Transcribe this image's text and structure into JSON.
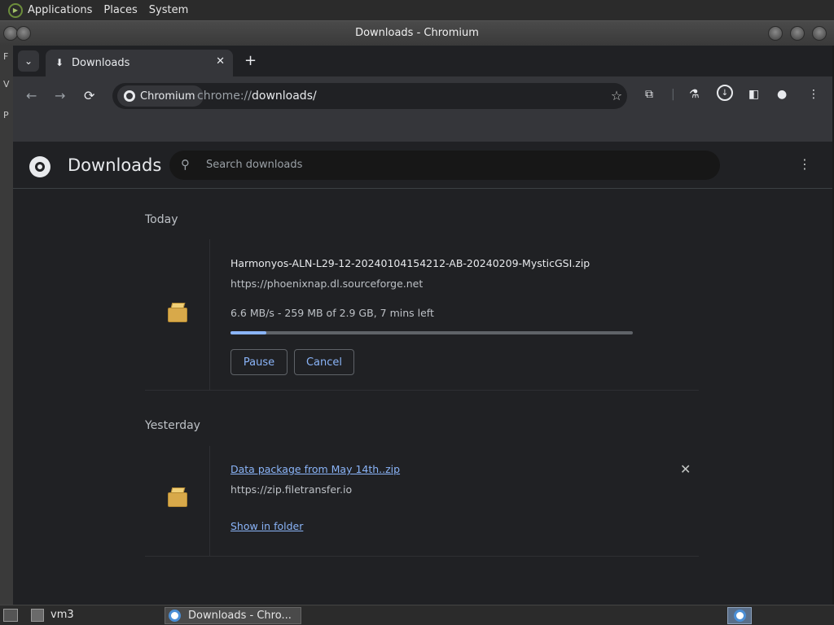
{
  "top_panel": {
    "menus": [
      "Applications",
      "Places",
      "System"
    ]
  },
  "window": {
    "title": "Downloads - Chromium"
  },
  "bg_window_fragments": [
    "F",
    "V",
    "P"
  ],
  "browser": {
    "tab": {
      "label": "Downloads",
      "close_glyph": "✕",
      "icon": "download-icon"
    },
    "new_tab_glyph": "+",
    "omnibox": {
      "chip_label": "Chromium",
      "url_scheme": "chrome://",
      "url_path": "downloads/"
    }
  },
  "page": {
    "title": "Downloads",
    "search_placeholder": "Search downloads",
    "sections": [
      {
        "label": "Today",
        "item": {
          "filename": "Harmonyos-ALN-L29-12-20240104154212-AB-20240209-MysticGSI.zip",
          "source": "https://phoenixnap.dl.sourceforge.net",
          "status": "6.6 MB/s - 259 MB of 2.9 GB, 7 mins left",
          "progress": 0.089,
          "buttons": [
            "Pause",
            "Cancel"
          ]
        }
      },
      {
        "label": "Yesterday",
        "item": {
          "filename": "Data package from May 14th..zip",
          "source": "https://zip.filetransfer.io",
          "action": "Show in folder"
        }
      }
    ]
  },
  "taskbar": {
    "workspace": "vm3",
    "task_label": "Downloads - Chro..."
  },
  "colors": {
    "accent": "#8ab4f8",
    "page_bg": "#202124",
    "toolbar_bg": "#35363a"
  }
}
